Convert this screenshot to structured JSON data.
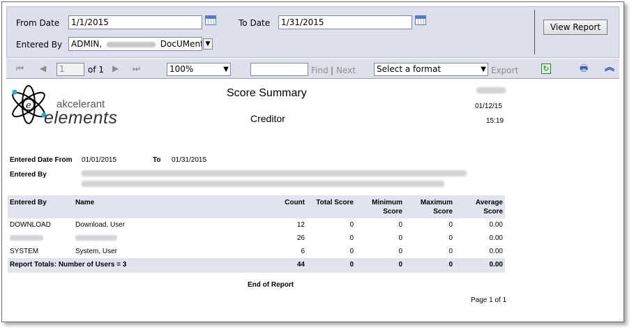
{
  "params": {
    "from_date_label": "From Date",
    "from_date_value": "1/1/2015",
    "to_date_label": "To Date",
    "to_date_value": "1/31/2015",
    "entered_by_label": "Entered By",
    "entered_by_value_prefix": "ADMIN,",
    "entered_by_value_suffix": "DocUMentc",
    "view_report_label": "View Report"
  },
  "toolbar": {
    "page_value": "1",
    "page_of_label": "of 1",
    "zoom_value": "100%",
    "find_value": "",
    "find_label": "Find",
    "separator": "|",
    "next_label": "Next",
    "format_value": "Select a format",
    "export_label": "Export",
    "icons": [
      "first-page-icon",
      "prev-page-icon",
      "next-page-icon",
      "last-page-icon",
      "refresh-icon",
      "print-icon",
      "collapse-icon"
    ]
  },
  "report": {
    "logo_line1": "akcelerant",
    "logo_line2": "elements",
    "title": "Score Summary",
    "subtitle": "Creditor",
    "date": "01/12/15",
    "time": "15:19",
    "entered_date_from_label": "Entered Date From",
    "entered_date_from_value": "01/01/2015",
    "to_label": "To",
    "to_value": "01/31/2015",
    "entered_by_label": "Entered By",
    "columns": [
      "Entered By",
      "Name",
      "Count",
      "Total Score",
      "Minimum Score",
      "Maximum Score",
      "Average Score"
    ],
    "columns_wrapped": {
      "min1": "Minimum",
      "min2": "Score",
      "max1": "Maximum",
      "max2": "Score",
      "avg1": "Average",
      "avg2": "Score"
    },
    "rows": [
      {
        "entered_by": "DOWNLOAD",
        "name": "Download, User",
        "count": "12",
        "total": "0",
        "min": "0",
        "max": "0",
        "avg": "0.00"
      },
      {
        "entered_by": "",
        "name": "",
        "count": "26",
        "total": "0",
        "min": "0",
        "max": "0",
        "avg": "0.00"
      },
      {
        "entered_by": "SYSTEM",
        "name": "System, User",
        "count": "6",
        "total": "0",
        "min": "0",
        "max": "0",
        "avg": "0.00"
      }
    ],
    "totals": {
      "label": "Report Totals: Number of Users = 3",
      "count": "44",
      "total": "0",
      "min": "0",
      "max": "0",
      "avg": "0.00"
    },
    "end_label": "End of Report",
    "page_label": "Page 1 of 1"
  }
}
